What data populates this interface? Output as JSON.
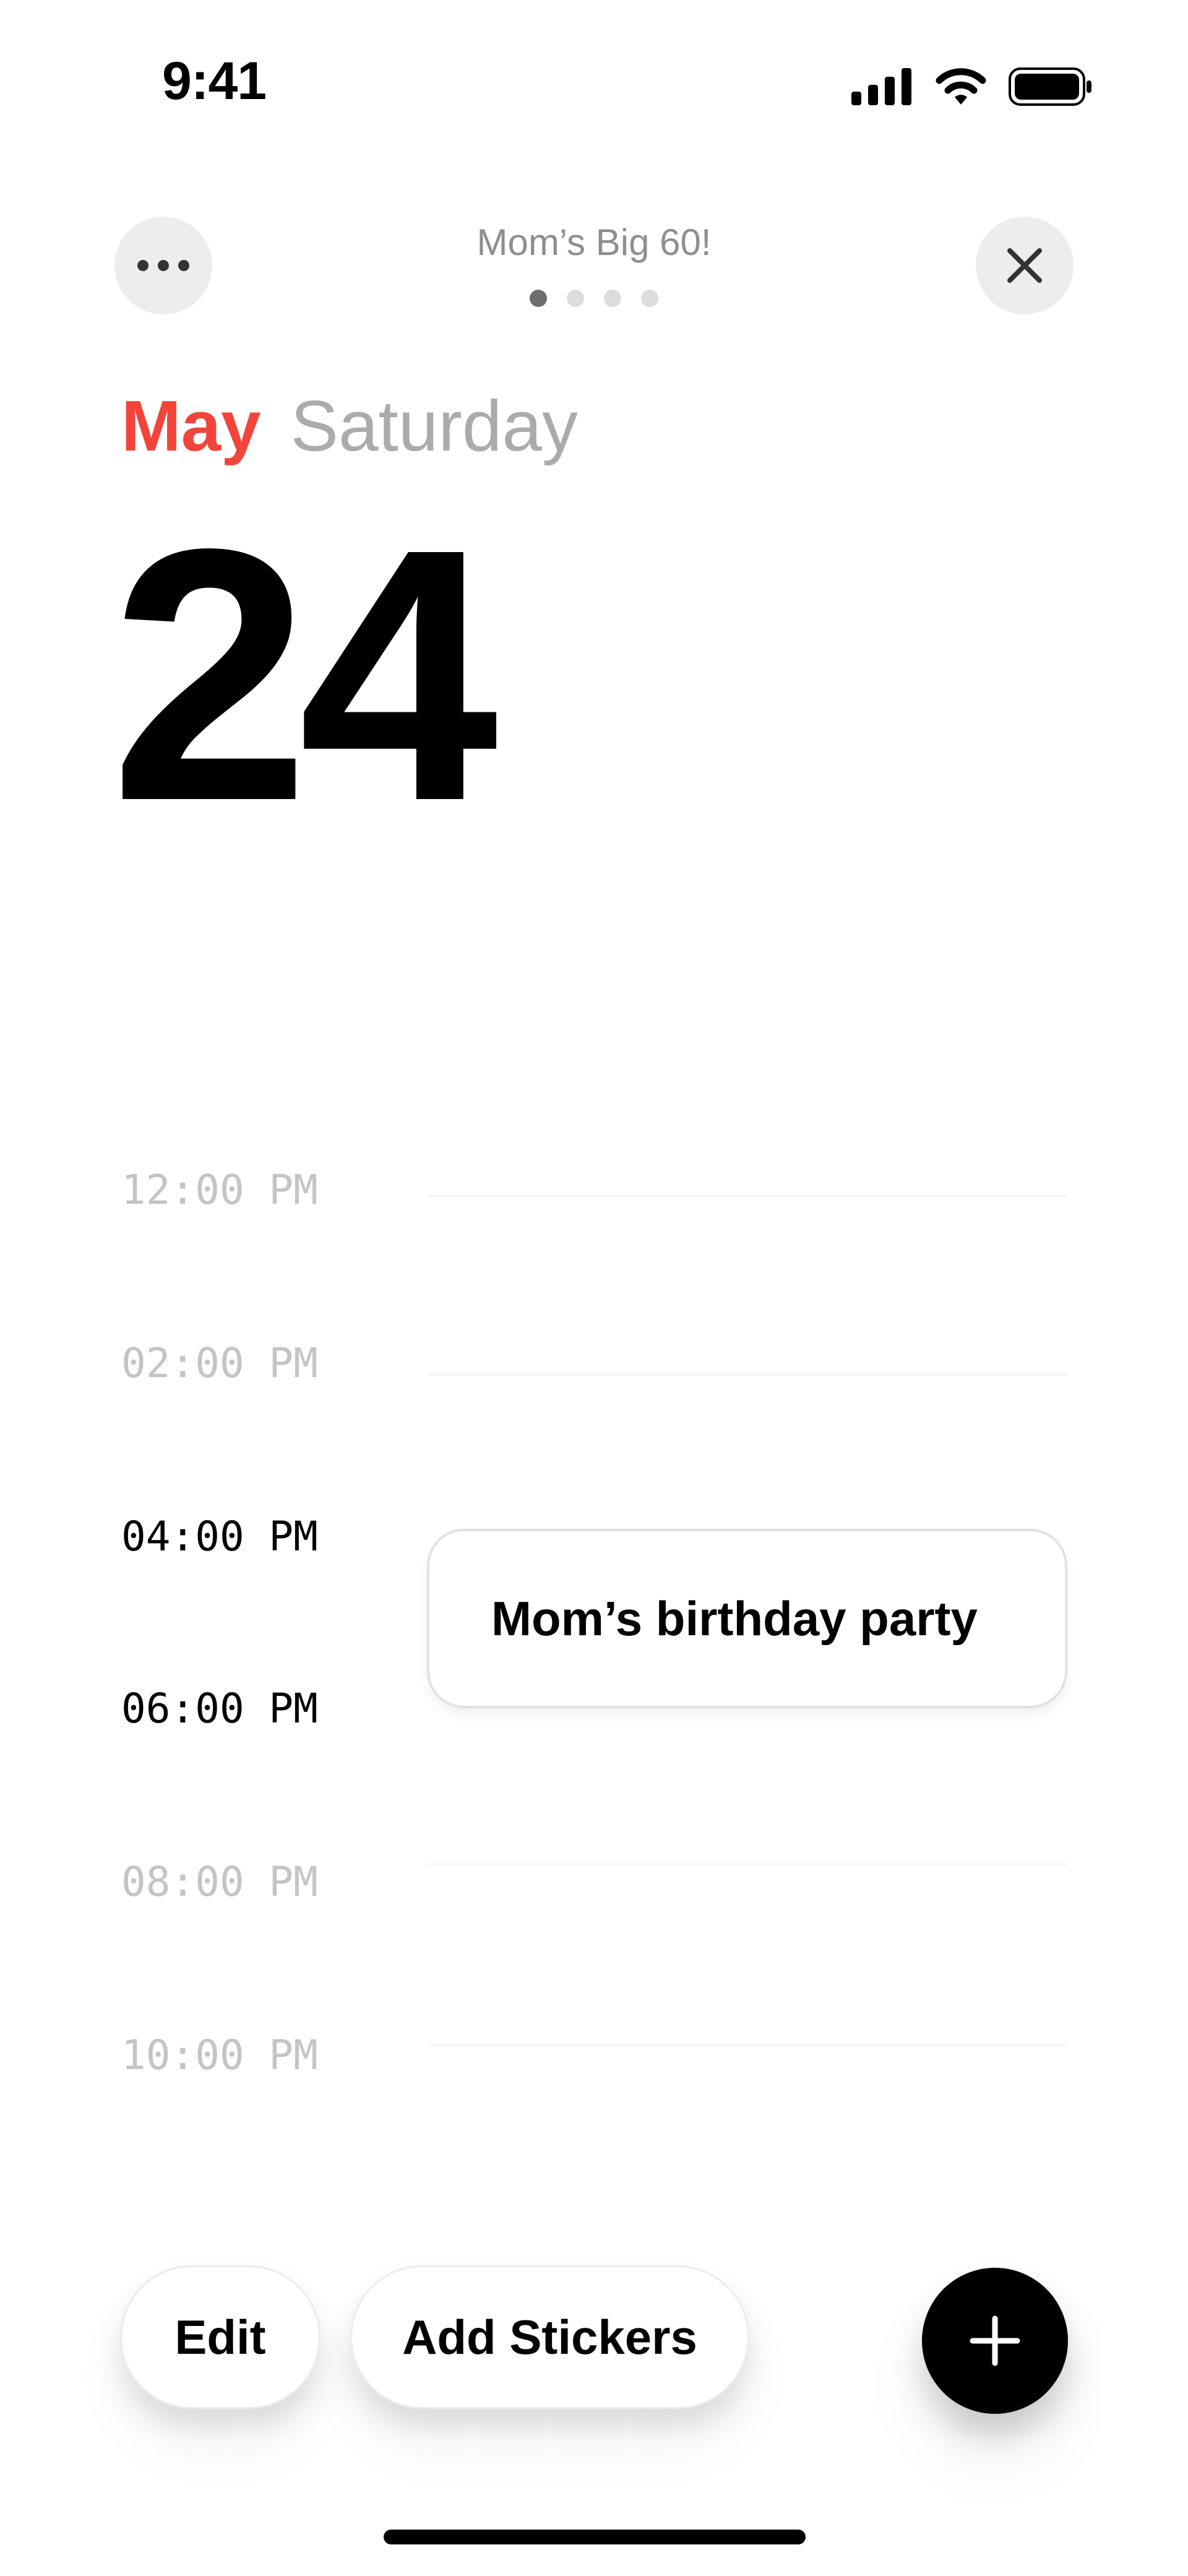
{
  "status_bar": {
    "time": "9:41",
    "icons": [
      "cellular-signal-icon",
      "wifi-icon",
      "battery-icon"
    ]
  },
  "header": {
    "title": "Mom’s Big 60!",
    "page_count": 4,
    "active_page": 1,
    "more_icon": "more-horizontal-icon",
    "close_icon": "close-icon"
  },
  "date": {
    "month": "May",
    "weekday": "Saturday",
    "day": "24"
  },
  "timeline": {
    "hours": [
      {
        "label": "12:00 PM",
        "active": false
      },
      {
        "label": "02:00 PM",
        "active": false
      },
      {
        "label": "04:00 PM",
        "active": true
      },
      {
        "label": "06:00 PM",
        "active": true
      },
      {
        "label": "08:00 PM",
        "active": false
      },
      {
        "label": "10:00 PM",
        "active": false
      }
    ]
  },
  "event": {
    "title": "Mom’s birthday party"
  },
  "toolbar": {
    "edit_label": "Edit",
    "add_stickers_label": "Add Stickers",
    "add_icon": "plus-icon"
  },
  "colors": {
    "accent": "#f2443a",
    "weekday": "#ababab",
    "muted_time": "#c4c4c4",
    "header_title": "#8e8e8e",
    "button_gray": "#ededed"
  }
}
